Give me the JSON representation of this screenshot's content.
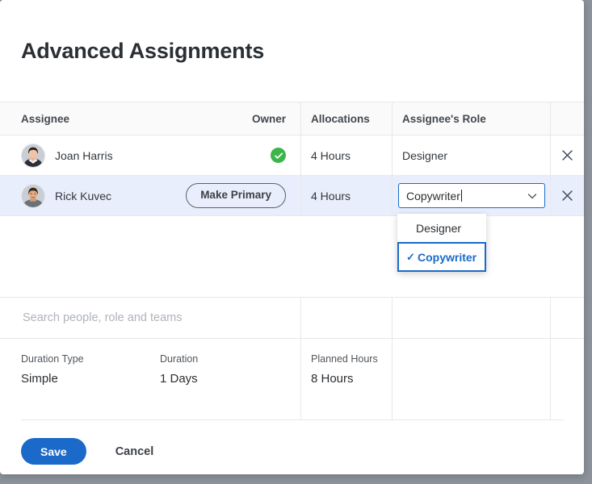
{
  "modal": {
    "title": "Advanced Assignments"
  },
  "table": {
    "columns": [
      {
        "key": "assignee",
        "label": "Assignee"
      },
      {
        "key": "owner",
        "label": "Owner"
      },
      {
        "key": "allocations",
        "label": "Allocations"
      },
      {
        "key": "role",
        "label": "Assignee's Role"
      },
      {
        "key": "action",
        "label": ""
      }
    ],
    "rows": [
      {
        "name": "Joan Harris",
        "avatar": "avatar-woman",
        "owner_state": "primary-owner-check",
        "owner_label": "",
        "allocations": "4 Hours",
        "role": "Designer",
        "remove_label": "×",
        "selected": false
      },
      {
        "name": "Rick Kuvec",
        "avatar": "avatar-man",
        "owner_state": "make-primary-button",
        "owner_label": "Make Primary",
        "allocations": "4 Hours",
        "role": "Copywriter",
        "remove_label": "×",
        "selected": true
      }
    ]
  },
  "role_dropdown": {
    "open": true,
    "value": "Copywriter",
    "options": [
      {
        "label": "Designer",
        "selected": false,
        "tick": ""
      },
      {
        "label": "Copywriter",
        "selected": true,
        "tick": "✓"
      }
    ]
  },
  "search": {
    "placeholder": "Search people, role and teams",
    "value": ""
  },
  "details": {
    "duration_type": {
      "label": "Duration Type",
      "value": "Simple"
    },
    "duration": {
      "label": "Duration",
      "value": "1 Days"
    },
    "planned_hours": {
      "label": "Planned Hours",
      "value": "8 Hours"
    }
  },
  "footer": {
    "save_label": "Save",
    "cancel_label": "Cancel"
  },
  "colors": {
    "accent_blue": "#1b6ac9",
    "owner_green": "#3cb54a",
    "selected_row": "#e8eefb",
    "header_bg": "#fafafa",
    "backdrop": "#8d939c",
    "border": "#e6e8eb"
  }
}
